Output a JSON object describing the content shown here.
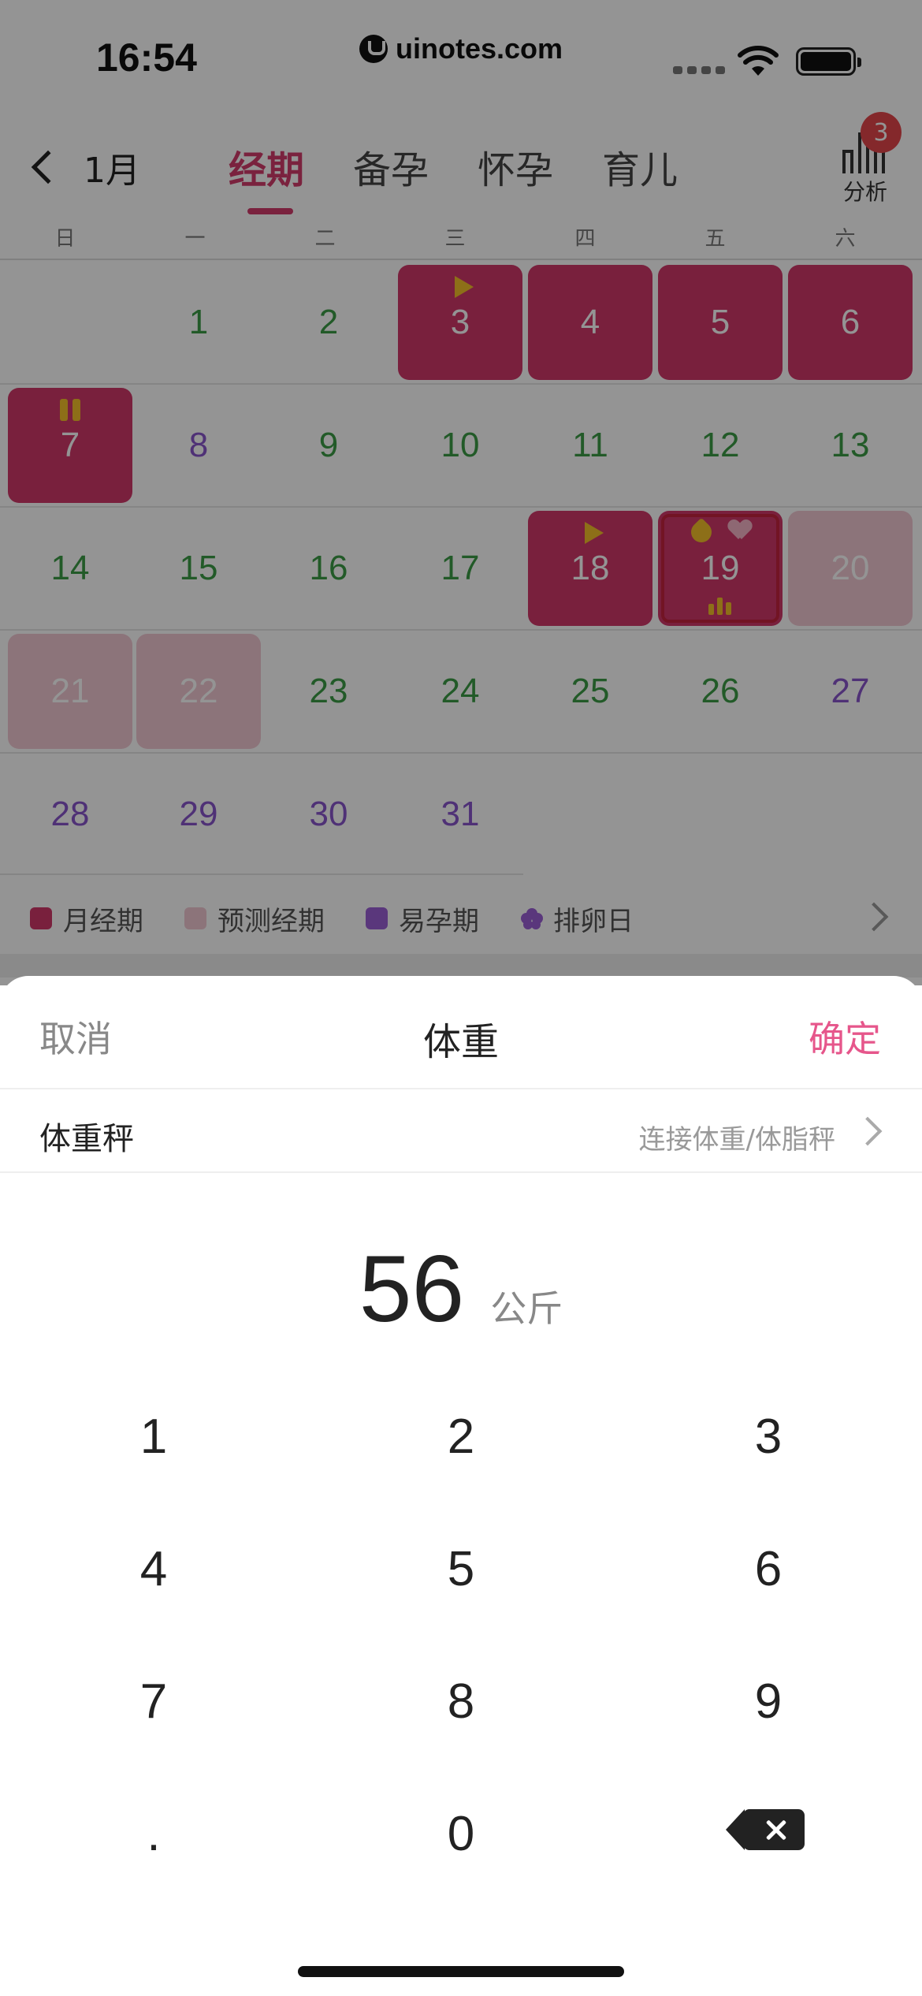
{
  "status_bar": {
    "time": "16:54",
    "watermark": "uinotes.com"
  },
  "nav": {
    "back_label": "1月",
    "tabs": [
      {
        "label": "经期",
        "active": true
      },
      {
        "label": "备孕",
        "active": false
      },
      {
        "label": "怀孕",
        "active": false
      },
      {
        "label": "育儿",
        "active": false
      }
    ],
    "analysis_label": "分析",
    "analysis_badge": "3"
  },
  "weekdays": [
    "日",
    "一",
    "二",
    "三",
    "四",
    "五",
    "六"
  ],
  "calendar": {
    "weeks": [
      [
        "",
        "1",
        "2",
        "3",
        "4",
        "5",
        "6"
      ],
      [
        "7",
        "8",
        "9",
        "10",
        "11",
        "12",
        "13"
      ],
      [
        "14",
        "15",
        "16",
        "17",
        "18",
        "19",
        "20"
      ],
      [
        "21",
        "22",
        "23",
        "24",
        "25",
        "26",
        "27"
      ],
      [
        "28",
        "29",
        "30",
        "31",
        "",
        "",
        ""
      ]
    ]
  },
  "legend": [
    {
      "label": "月经期",
      "color": "#d0386a"
    },
    {
      "label": "预测经期",
      "color": "#f2c9d3"
    },
    {
      "label": "易孕期",
      "color": "#9b5fd6"
    },
    {
      "label": "排卵日",
      "color": "#9b5fd6"
    }
  ],
  "sheet": {
    "cancel": "取消",
    "title": "体重",
    "confirm": "确定",
    "scale_label": "体重秤",
    "scale_link": "连接体重/体脂秤",
    "weight_value": "56",
    "weight_unit": "公斤",
    "keys": [
      [
        "1",
        "2",
        "3"
      ],
      [
        "4",
        "5",
        "6"
      ],
      [
        "7",
        "8",
        "9"
      ],
      [
        ".",
        "0",
        "delete"
      ]
    ]
  },
  "colors": {
    "accent": "#d33b6b",
    "confirm": "#e6568b",
    "period": "#d0386a",
    "predict": "#f2c9d3",
    "safe": "#3c9c46",
    "fertile": "#8855cc"
  }
}
